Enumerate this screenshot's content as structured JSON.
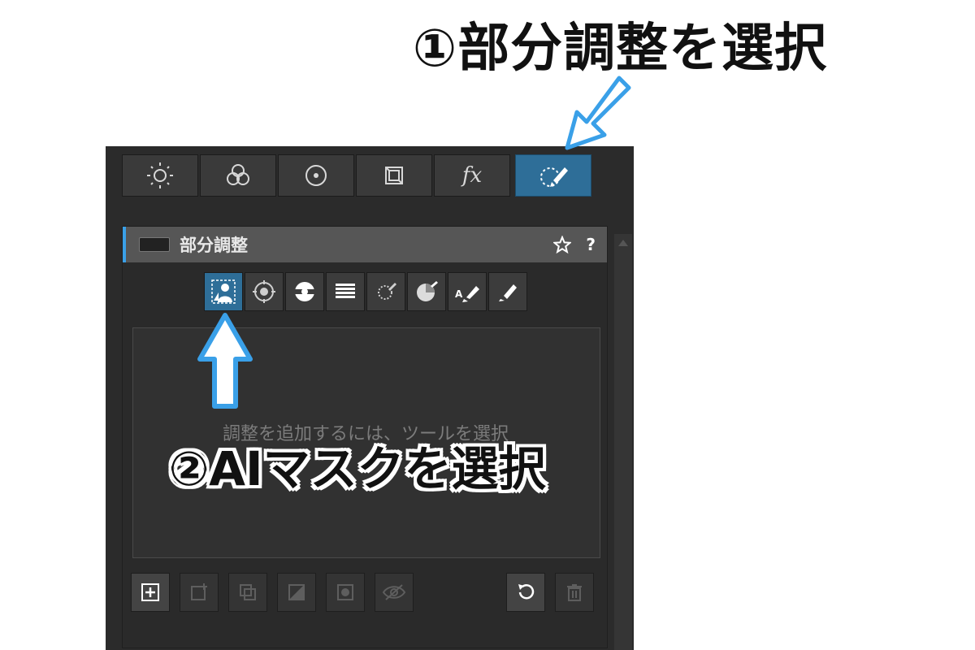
{
  "annotations": {
    "step1": "①部分調整を選択",
    "step2": "②AIマスクを選択"
  },
  "colors": {
    "accent": "#2e6e98",
    "arrow": "#3aa0e8"
  },
  "tabs": [
    {
      "icon": "brightness-icon",
      "label": ""
    },
    {
      "icon": "color-circles-icon",
      "label": ""
    },
    {
      "icon": "detail-icon",
      "label": ""
    },
    {
      "icon": "frame-icon",
      "label": ""
    },
    {
      "icon": "fx-icon",
      "label": "fx"
    },
    {
      "icon": "local-adjust-brush-icon",
      "label": "",
      "active": true
    }
  ],
  "section": {
    "title": "部分調整",
    "star_icon": "star-icon",
    "help_label": "?"
  },
  "tools": [
    {
      "icon": "ai-mask-person-icon",
      "active": true
    },
    {
      "icon": "radial-gradient-icon"
    },
    {
      "icon": "ring-gradient-icon"
    },
    {
      "icon": "linear-gradient-icon"
    },
    {
      "icon": "color-picker-icon"
    },
    {
      "icon": "luminance-icon"
    },
    {
      "icon": "auto-brush-icon",
      "label": "A"
    },
    {
      "icon": "brush-icon"
    }
  ],
  "mask_area": {
    "hint": "調整を追加するには、ツールを選択"
  },
  "bottom": {
    "add_icon": "add-icon",
    "icons": [
      "new-mask-icon",
      "duplicate-icon",
      "invert-icon",
      "mask-show-icon",
      "hide-icon"
    ],
    "reset_icon": "reset-icon",
    "delete_icon": "trash-icon"
  }
}
